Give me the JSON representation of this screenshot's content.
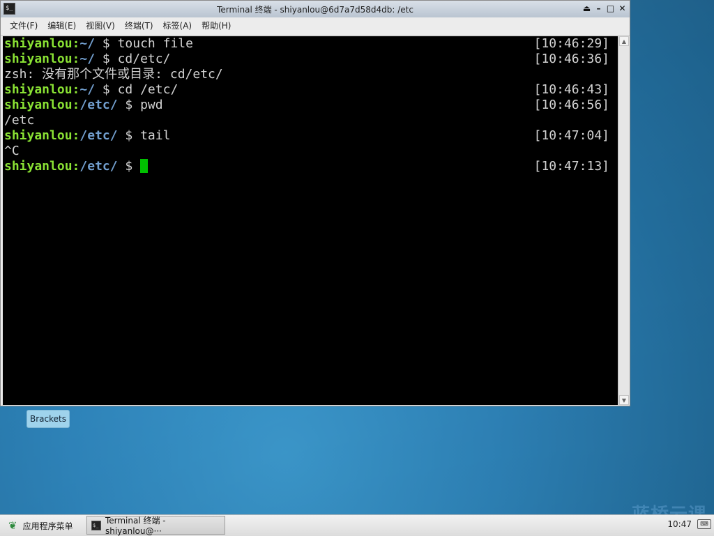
{
  "window": {
    "title": "Terminal 终端 - shiyanlou@6d7a7d58d4db: /etc",
    "controls": [
      "⏏",
      "–",
      "□",
      "✕"
    ]
  },
  "menu": [
    "文件(F)",
    "编辑(E)",
    "视图(V)",
    "终端(T)",
    "标签(A)",
    "帮助(H)"
  ],
  "terminal": {
    "lines": [
      {
        "user": "shiyanlou",
        "sep": ":",
        "path": "~/",
        "cmd": " $ touch file",
        "time": "[10:46:29]"
      },
      {
        "user": "shiyanlou",
        "sep": ":",
        "path": "~/",
        "cmd": " $ cd/etc/",
        "time": "[10:46:36]"
      },
      {
        "output": "zsh: 没有那个文件或目录: cd/etc/"
      },
      {
        "user": "shiyanlou",
        "sep": ":",
        "path": "~/",
        "cmd": " $ cd /etc/",
        "time": "[10:46:43]"
      },
      {
        "user": "shiyanlou",
        "sep": ":",
        "path": "/etc/",
        "cmd": " $ pwd",
        "time": "[10:46:56]"
      },
      {
        "output": "/etc"
      },
      {
        "user": "shiyanlou",
        "sep": ":",
        "path": "/etc/",
        "cmd": " $ tail",
        "time": "[10:47:04]"
      },
      {
        "output": "^C"
      },
      {
        "user": "shiyanlou",
        "sep": ":",
        "path": "/etc/",
        "cmd": " $ ",
        "time": "[10:47:13]",
        "cursor": true
      }
    ]
  },
  "desktop": {
    "label": "Brackets"
  },
  "taskbar": {
    "start_label": "应用程序菜单",
    "task_label": "Terminal 终端 - shiyanlou@···",
    "clock": "10:47",
    "watermark": "蓝桥云课"
  },
  "colors": {
    "user": "#8ae234",
    "path": "#729fcf",
    "cursor": "#00c000",
    "terminal_bg": "#000000"
  },
  "icons": {
    "terminal_app": "terminal-icon",
    "start": "leaf-icon",
    "keyboard": "keyboard-icon"
  }
}
